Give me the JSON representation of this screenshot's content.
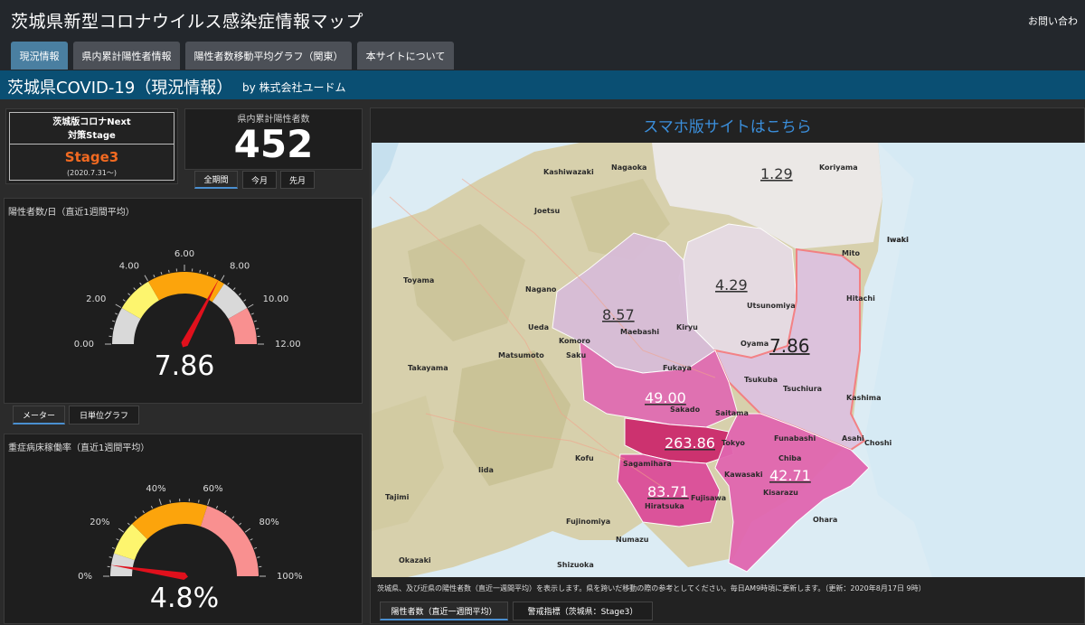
{
  "header": {
    "title": "茨城県新型コロナウイルス感染症情報マップ",
    "contact": "お問い合わ"
  },
  "nav": {
    "tabs": [
      "現況情報",
      "県内累計陽性者情報",
      "陽性者数移動平均グラフ（関東）",
      "本サイトについて"
    ],
    "active": 0
  },
  "page": {
    "title": "茨城県COVID-19（現況情報）",
    "byline": "by 株式会社ユードム"
  },
  "stage": {
    "line1": "茨城版コロナNext",
    "line2": "対策Stage",
    "value": "Stage3",
    "date": "(2020.7.31〜)",
    "value_color": "#f26a21"
  },
  "total": {
    "label": "県内累計陽性者数",
    "value": "452",
    "tabs": [
      "全期間",
      "今月",
      "先月"
    ],
    "active": 0
  },
  "gauge_daily": {
    "title": "陽性者数/日（直近1週間平均）",
    "ticks": [
      "0.00",
      "2.00",
      "4.00",
      "6.00",
      "8.00",
      "10.00",
      "12.00"
    ],
    "value": 7.86,
    "min": 0,
    "max": 12,
    "display": "7.86",
    "tabs": [
      "メーター",
      "日単位グラフ"
    ],
    "active": 0
  },
  "gauge_bed": {
    "title": "重症病床稼働率（直近1週間平均）",
    "ticks": [
      "0%",
      "20%",
      "40%",
      "60%",
      "80%",
      "100%"
    ],
    "value": 4.8,
    "min": 0,
    "max": 100,
    "display": "4.8%"
  },
  "colors": {
    "gray": "#d9d9d9",
    "yellow": "#fdf56e",
    "orange": "#fca40c",
    "red": "#f99090",
    "needle": "#e0101c",
    "accent": "#3b8fdc",
    "header_blue": "#0a4f73"
  },
  "map": {
    "link": "スマホ版サイトはこちら",
    "values": {
      "fukushima": "1.29",
      "tochigi": "4.29",
      "gunma": "8.57",
      "ibaraki": "7.86",
      "saitama": "49.00",
      "tokyo": "263.86",
      "chiba": "42.71",
      "kanagawa": "83.71"
    },
    "places": [
      "Kashiwazaki",
      "Nagaoka",
      "Joetsu",
      "Toyama",
      "Nagano",
      "Ueda",
      "Komoro",
      "Matsumoto",
      "Saku",
      "Takayama",
      "Kofu",
      "Iida",
      "Tajimi",
      "Fujinomiya",
      "Numazu",
      "Okazaki",
      "Shizuoka",
      "Koriyama",
      "Iwaki",
      "Hitachi",
      "Kashima",
      "Choshi",
      "Tsukuba",
      "Tsuchiura",
      "Utsunomiya",
      "Oyama",
      "Maebashi",
      "Kiryu",
      "Fukaya",
      "Sakado",
      "Saitama",
      "Funabashi",
      "Tokyo",
      "Sagamihara",
      "Kawasaki",
      "Fujisawa",
      "Hiratsuka",
      "Kisarazu",
      "Chiba",
      "Ohara",
      "Asahi",
      "Mito",
      "Iwaki"
    ],
    "note": "茨城県、及び近県の陽性者数（直近一週間平均）を表示します。県を跨いだ移動の際の参考としてください。毎日AM9時頃に更新します。（更新：2020年8月17日 9時）",
    "tabs": [
      "陽性者数（直近一週間平均）",
      "警戒指標（茨城県：Stage3）"
    ],
    "active": 0
  }
}
